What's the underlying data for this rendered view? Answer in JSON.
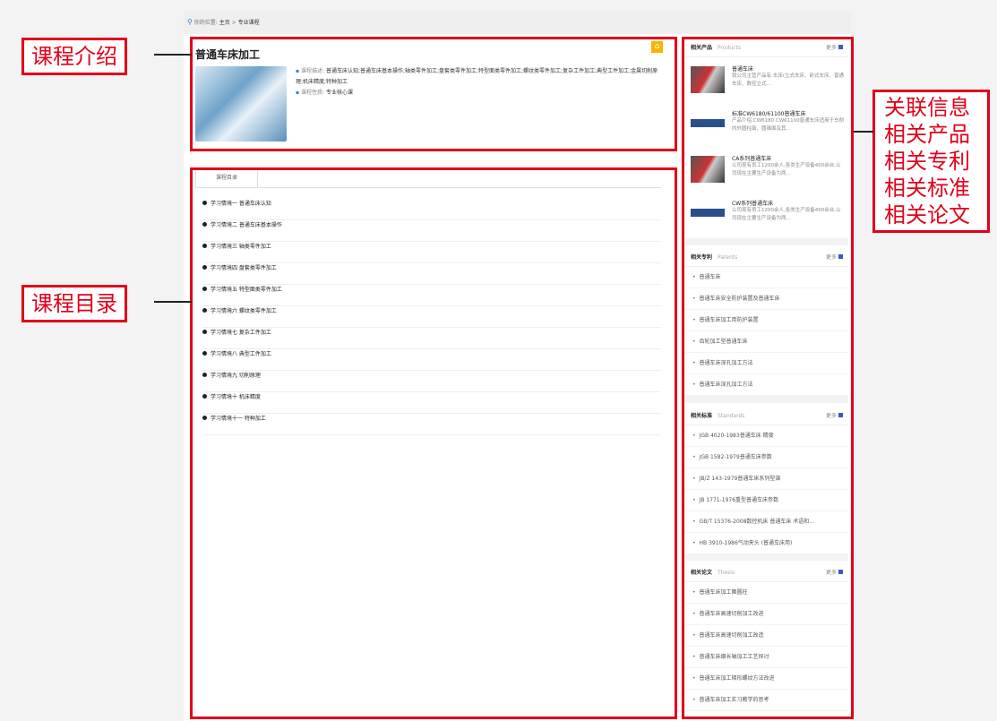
{
  "breadcrumb": {
    "prefix": "你的位置:",
    "home": "主页",
    "current": "专业课程"
  },
  "course": {
    "title": "普通车床加工",
    "desc_label": "课程描述:",
    "desc": "普通车床认知;普通车床基本操作;轴类零件加工;盘套类零件加工;特型面类零件加工;螺纹类零件加工;复杂工件加工;典型工件加工;金属切削原理;机床精度;特种加工",
    "type_label": "课程性质:",
    "type": "专业核心课"
  },
  "tab": "课程目录",
  "toc": [
    "学习情境一 普通车床认知",
    "学习情境二 普通车床基本操作",
    "学习情境三 轴类零件加工",
    "学习情境四 盘套类零件加工",
    "学习情境五 特型面类零件加工",
    "学习情境六 螺纹类零件加工",
    "学习情境七 复杂工件加工",
    "学习情境八 典型工件加工",
    "学习情境九 切削原理",
    "学习情境十 机床精度",
    "学习情境十一 特种加工"
  ],
  "products": {
    "title": "相关产品",
    "en": "Products",
    "more": "更多",
    "items": [
      {
        "t": "普通车床",
        "d": "我公司主营产品有:车床(立式车床、卧式车床、普通车床、数控立式..."
      },
      {
        "t": "标准CW6180/61100普通车床",
        "d": "产品介绍:CW6180 CW61100普通车床适用于车削内外圆柱面、圆锥面及其..."
      },
      {
        "t": "CA系列普通车床",
        "d": "公司现有员工1200余人,各类生产设备400余台,公司现在主要生产设备为两..."
      },
      {
        "t": "CW系列普通车床",
        "d": "公司现有员工1200余人,各类生产设备400余台,公司现在主要生产设备为两..."
      }
    ]
  },
  "patents": {
    "title": "相关专利",
    "en": "Patents",
    "more": "更多",
    "items": [
      "普通车床",
      "普通车床安全防护装置及普通车床",
      "普通车床加工用防护装置",
      "齿轮加工型普通车床",
      "普通车床深孔加工方法",
      "普通车床深孔加工方法"
    ]
  },
  "standards": {
    "title": "相关标准",
    "en": "Standards",
    "more": "更多",
    "items": [
      "JGB 4020-1983普通车床 精度",
      "JGB 1582-1979普通车床参数",
      "JB/Z 143-1979普通车床系列型谱",
      "JB 1771-1976重型普通车床参数",
      "GB/T 15376-2008数控机床 普通车床 术语和...",
      "HB 3910-1986气动夹头 (普通车床用)"
    ]
  },
  "thesis": {
    "title": "相关论文",
    "en": "Thesis",
    "more": "更多",
    "items": [
      "普通车床加工舞圆柱",
      "普通车床高速切削加工改进",
      "普通车床高速切削加工改造",
      "普通车床细长轴加工工艺探讨",
      "普通车床加工梯形螺纹方法改进",
      "普通车床加工实习教学的思考"
    ]
  },
  "callouts": {
    "intro": "课程介绍",
    "toc": "课程目录",
    "related": [
      "关联信息",
      "相关产品",
      "相关专利",
      "相关标准",
      "相关论文"
    ]
  }
}
